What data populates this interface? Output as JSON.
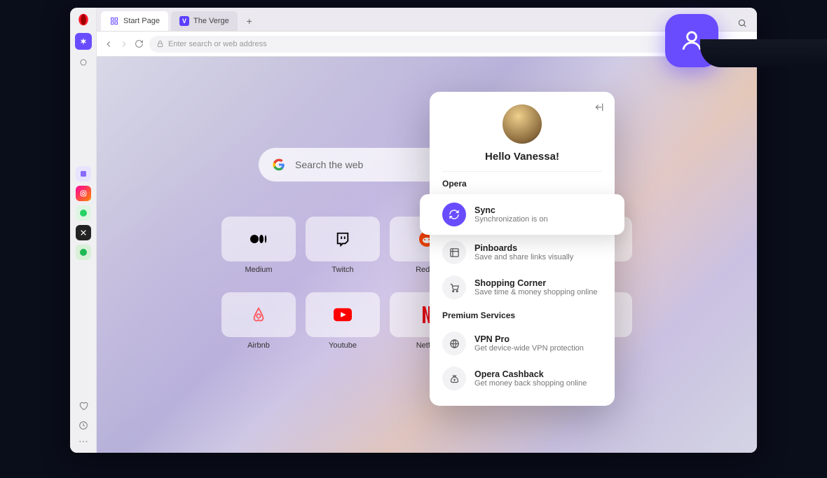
{
  "tabs": [
    {
      "label": "Start Page",
      "active": true
    },
    {
      "label": "The Verge",
      "active": false
    }
  ],
  "address": {
    "placeholder": "Enter search or web address"
  },
  "search": {
    "placeholder": "Search the web"
  },
  "speed_dial": [
    {
      "label": "Medium",
      "fg": "#000"
    },
    {
      "label": "Twitch",
      "fg": "#000"
    },
    {
      "label": "Reddit",
      "fg": "#ff4500"
    },
    {
      "label": "",
      "fg": "#000"
    },
    {
      "label": "",
      "fg": "#000"
    },
    {
      "label": "Airbnb",
      "fg": "#ff5a5f"
    },
    {
      "label": "Youtube",
      "fg": "#ff0000"
    },
    {
      "label": "Netflix",
      "fg": "#e50914"
    },
    {
      "label": "",
      "fg": "#000"
    },
    {
      "label": "",
      "fg": "#000"
    }
  ],
  "profile": {
    "greeting": "Hello Vanessa!",
    "sections": {
      "opera": {
        "title": "Opera",
        "items": [
          {
            "title": "Sync",
            "subtitle": "Synchronization is on",
            "active": true
          },
          {
            "title": "Pinboards",
            "subtitle": "Save and share links visually"
          },
          {
            "title": "Shopping Corner",
            "subtitle": "Save time & money shopping online"
          }
        ]
      },
      "premium": {
        "title": "Premium Services",
        "items": [
          {
            "title": "VPN Pro",
            "subtitle": "Get device-wide VPN protection"
          },
          {
            "title": "Opera Cashback",
            "subtitle": "Get money back shopping online"
          }
        ]
      }
    }
  },
  "colors": {
    "accent": "#6a4cff"
  }
}
